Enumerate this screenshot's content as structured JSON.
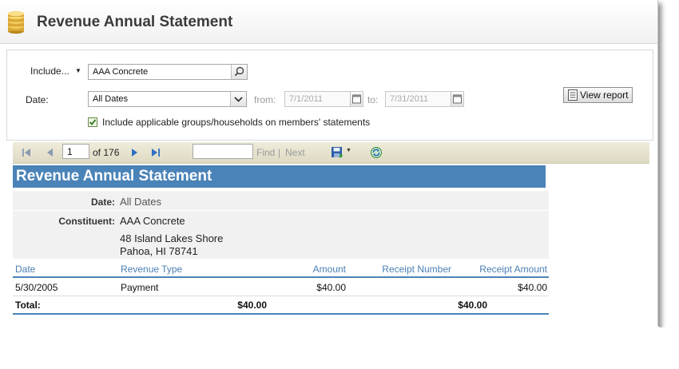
{
  "header": {
    "title": "Revenue Annual Statement",
    "icon": "coin-stack-icon"
  },
  "params": {
    "include_label": "Include...",
    "include_value": "AAA Concrete",
    "date_label": "Date:",
    "date_value": "All Dates",
    "from_label": "from:",
    "from_value": "7/1/2011",
    "to_label": "to:",
    "to_value": "7/31/2011",
    "groups_checkbox_label": "Include applicable groups/households on members' statements",
    "groups_checked": true,
    "view_report_label": "View report"
  },
  "toolbar": {
    "page_value": "1",
    "page_of": "of 176",
    "find_label": "Find",
    "separator": "|",
    "next_label": "Next"
  },
  "report": {
    "title": "Revenue Annual Statement",
    "date_caption": "Date:",
    "date_value": "All Dates",
    "constituent_caption": "Constituent:",
    "constituent_name": "AAA Concrete",
    "address_line1": "48 Island Lakes Shore",
    "address_line2": "Pahoa, HI  78741",
    "columns": [
      "Date",
      "Revenue Type",
      "Amount",
      "Receipt Number",
      "Receipt Amount"
    ],
    "rows": [
      {
        "date": "5/30/2005",
        "type": "Payment",
        "amount": "$40.00",
        "receipt_number": "",
        "receipt_amount": "$40.00"
      }
    ],
    "total_label": "Total:",
    "total_amount": "$40.00",
    "total_receipt_amount": "$40.00"
  },
  "colors": {
    "title_bar": "#4a83b8",
    "header_text": "#4a7fb4",
    "toolbar_bg": "#e6e2cf"
  }
}
